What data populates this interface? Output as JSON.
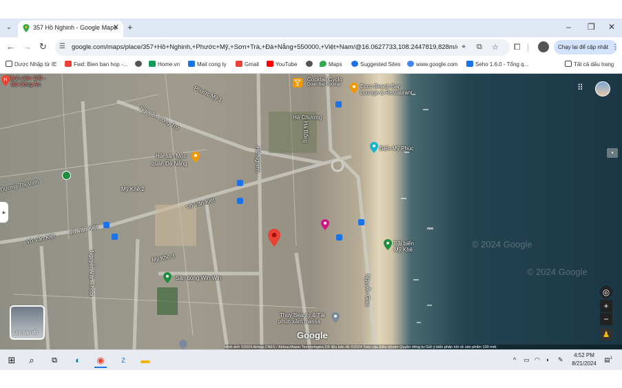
{
  "browser": {
    "tab_title": "357 Hồ Nghinh - Google Maps",
    "tab_close": "✕",
    "new_tab": "+",
    "url": "google.com/maps/place/357+Hồ+Nghinh,+Phước+Mỹ,+Sơn+Trà,+Đà+Nẵng+550000,+Việt+Nam/@16.0627733,108.2447819,828m/da...",
    "relaunch_label": "Chạy lại để cập nhật",
    "window_controls": {
      "minimize": "–",
      "maximize": "❐",
      "close": "✕"
    }
  },
  "bookmarks": [
    {
      "label": "Dược Nhập từ IE",
      "color": "#f4b400"
    },
    {
      "label": "Fwd: Bien ban hop -...",
      "color": "#ea4335"
    },
    {
      "label": "",
      "color": "#555555"
    },
    {
      "label": "Home.vn",
      "color": "#0f9d58"
    },
    {
      "label": "Mail cong ty",
      "color": "#1a73e8"
    },
    {
      "label": "Gmail",
      "color": "#ea4335"
    },
    {
      "label": "YouTube",
      "color": "#ff0000"
    },
    {
      "label": "",
      "color": "#555555"
    },
    {
      "label": "Maps",
      "color": "#34a853"
    },
    {
      "label": "Suggested Sites",
      "color": "#1a73e8"
    },
    {
      "label": "www.google.com",
      "color": "#4285f4"
    },
    {
      "label": "Seho 1.6.0 - Tổng q...",
      "color": "#1a73e8"
    }
  ],
  "bookmarks_all": "Tất cả dấu trang",
  "map": {
    "labels": {
      "benh_vien": "Bệnh viện 199 -",
      "bo_cong_an": "Bộ Công An",
      "cocktail": "Cocktail Cyclo",
      "quan_bar": "Quán Bar Cocktail",
      "ecco": "Ecco Beach Bar",
      "lounge": "Lounge & Restaurant",
      "ha_chuong": "Hà Chương",
      "nguyen_cong_tru": "Nguyễn Công Trứ",
      "phuoc_my": "Phước Mỹ 1",
      "hai_san": "Hải sản Mộc",
      "quan_da_nang": "quán Đà Nẵng",
      "bien_my_phuc": "Biển Mỹ Phúc",
      "ho_nghinh": "Hồ Nghinh",
      "ha_bong": "Hà Bổng",
      "my_khe_2": "Mỹ Khê 2",
      "vo_van_kiet": "Võ Văn Kiệt",
      "my_khe_3": "Mỹ Khê 3",
      "bai_bien": "Bãi biển",
      "my_khe": "Mỹ Khê",
      "san_bong": "Sân bóng Win Win",
      "thuy_beauty": "Thuy Beauty & Tài",
      "phun_xam": "phun xăm massa",
      "nguyen_van_thoai": "Nguyễn Văn Thoại",
      "nguyen_giao": "Nguyễn Giao",
      "duong_thi_vinh": "Dương Thị Vinh"
    },
    "watermark_1": "© 2024 Google",
    "watermark_2": "© 2024 Google",
    "google_logo": "Google",
    "layers_label": "Lớp bản đồ",
    "attribution": "Hình ảnh ©2024 Airbus,CNES / Airbus,Maxar Technologies,Dữ liệu bản đồ ©2024   Toàn cầu   Điều khoản   Quyền riêng tư   Gửi ý kiến phản hồi về sản phẩm   100 mét",
    "zoom_in": "+",
    "zoom_out": "−"
  },
  "taskbar": {
    "time": "4:52 PM",
    "date": "8/21/2024",
    "notification_count": "1"
  },
  "colors": {
    "pin_red": "#ea4335",
    "poi_orange": "#f29900",
    "poi_green": "#1e8e3e",
    "poi_pink": "#d01884",
    "poi_blue": "#1a73e8"
  }
}
